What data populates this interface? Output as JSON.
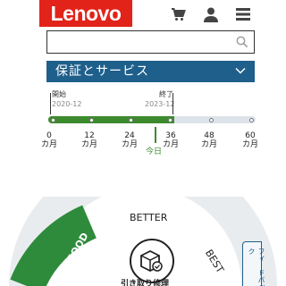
{
  "header": {
    "logo_text": "Lenovo",
    "brand_color": "#e2231a",
    "icons": [
      "cart-icon",
      "user-icon",
      "menu-icon"
    ]
  },
  "search": {
    "value": "",
    "placeholder": "",
    "icon": "search-icon"
  },
  "warranty": {
    "label": "保証とサービス",
    "icon": "chevron-down-icon",
    "color": "#1f5f8b"
  },
  "timeline": {
    "start_label": "開始",
    "start_date": "2020-12",
    "end_label": "終了",
    "end_date": "2023-12",
    "today_label": "今日",
    "progress_color": "#3d8a2e",
    "covered_months": 36,
    "max_months": 60,
    "ticks": [
      {
        "num": "0",
        "unit": "カ月"
      },
      {
        "num": "12",
        "unit": "カ月"
      },
      {
        "num": "24",
        "unit": "カ月"
      },
      {
        "num": "36",
        "unit": "カ月"
      },
      {
        "num": "48",
        "unit": "カ月"
      },
      {
        "num": "60",
        "unit": "カ月"
      }
    ]
  },
  "gauge": {
    "better": "BETTER",
    "good": "GOOD",
    "best": "BEST",
    "good_color": "#2e8b3b",
    "partial_label": "引き取り修理"
  },
  "side_tab": {
    "label": "フィードバック"
  }
}
